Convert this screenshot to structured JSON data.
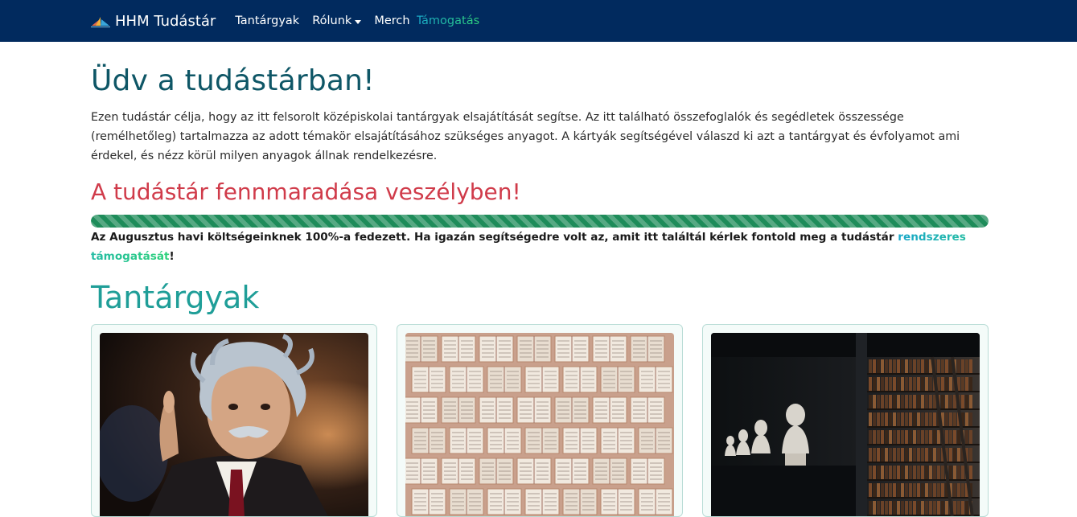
{
  "nav": {
    "brand": "HHM Tudástár",
    "links": [
      {
        "label": "Tantárgyak"
      },
      {
        "label": "Rólunk",
        "dropdown": true
      },
      {
        "label": "Merch"
      }
    ],
    "support": "Támogatás"
  },
  "main": {
    "title": "Üdv a tudástárban!",
    "intro": "Ezen tudástár célja, hogy az itt felsorolt középiskolai tantárgyak elsajátítását segítse. Az itt található összefoglalók és segédletek összessége (remélhetőleg) tartalmazza az adott témakör elsajátításához szükséges anyagot. A kártyák segítségével válaszd ki azt a tantárgyat és évfolyamot ami érdekel, és nézz körül milyen anyagok állnak rendelkezésre.",
    "warning_title": "A tudástár fennmaradása veszélyben!",
    "funding_progress_percent": 100,
    "funding_text": "Az Augusztus havi költségeinknek 100%-a fedezett. Ha igazán segítségedre volt az, amit itt találtál kérlek fontold meg a tudástár ",
    "funding_link": "rendszeres támogatását",
    "funding_end": "!",
    "subjects_title": "Tantárgyak"
  },
  "cards": [
    {
      "image": "einstein-figurine"
    },
    {
      "image": "open-books-wall"
    },
    {
      "image": "library-busts"
    }
  ],
  "colors": {
    "navbar": "#012a5e",
    "title": "#0e5666",
    "warning": "#d03b4a",
    "progress": "#1e8c5a",
    "subjects": "#1f9e98"
  }
}
